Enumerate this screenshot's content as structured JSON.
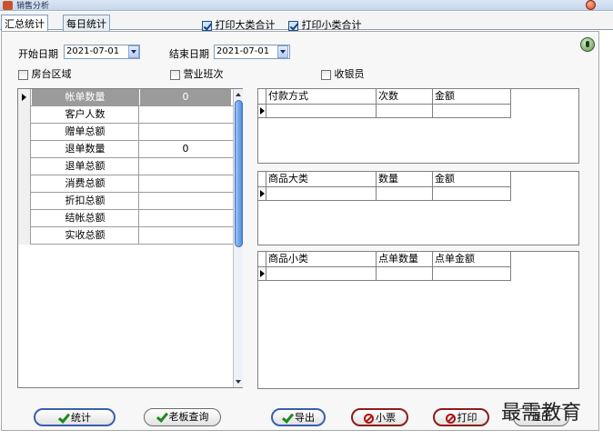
{
  "window": {
    "title": "销售分析"
  },
  "tabs": [
    {
      "label": "汇总统计"
    },
    {
      "label": "每日统计"
    }
  ],
  "top_options": {
    "print_category_total": {
      "label": "打印大类合计",
      "checked": true
    },
    "print_subcategory_total": {
      "label": "打印小类合计",
      "checked": true
    }
  },
  "filters": {
    "start_date_label": "开始日期",
    "start_date_value": "2021-07-01",
    "end_date_label": "结束日期",
    "end_date_value": "2021-07-01",
    "room_area_label": "房台区域",
    "shift_label": "营业班次",
    "cashier_label": "收银员"
  },
  "summary": {
    "rows": [
      {
        "label": "帐单数量",
        "value": "0"
      },
      {
        "label": "客户人数",
        "value": ""
      },
      {
        "label": "赠单总额",
        "value": ""
      },
      {
        "label": "退单数量",
        "value": "0"
      },
      {
        "label": "退单总额",
        "value": ""
      },
      {
        "label": "消费总额",
        "value": ""
      },
      {
        "label": "折扣总额",
        "value": ""
      },
      {
        "label": "结帐总额",
        "value": ""
      },
      {
        "label": "实收总额",
        "value": ""
      }
    ]
  },
  "payment_table": {
    "columns": [
      "付款方式",
      "次数",
      "金额"
    ]
  },
  "category_table": {
    "columns": [
      "商品大类",
      "数量",
      "金额"
    ]
  },
  "subcategory_table": {
    "columns": [
      "商品小类",
      "点单数量",
      "点单金额"
    ]
  },
  "buttons": {
    "stats": "统计",
    "boss_query": "老板查询",
    "export": "导出",
    "ticket": "小票",
    "print": "打印",
    "exit": "退出"
  },
  "watermark": "最需教育",
  "colors": {
    "accent": "#3a5fb0",
    "selected_row": "#9b9b9b",
    "stop": "#b01212",
    "ok": "#1c8a1c"
  }
}
